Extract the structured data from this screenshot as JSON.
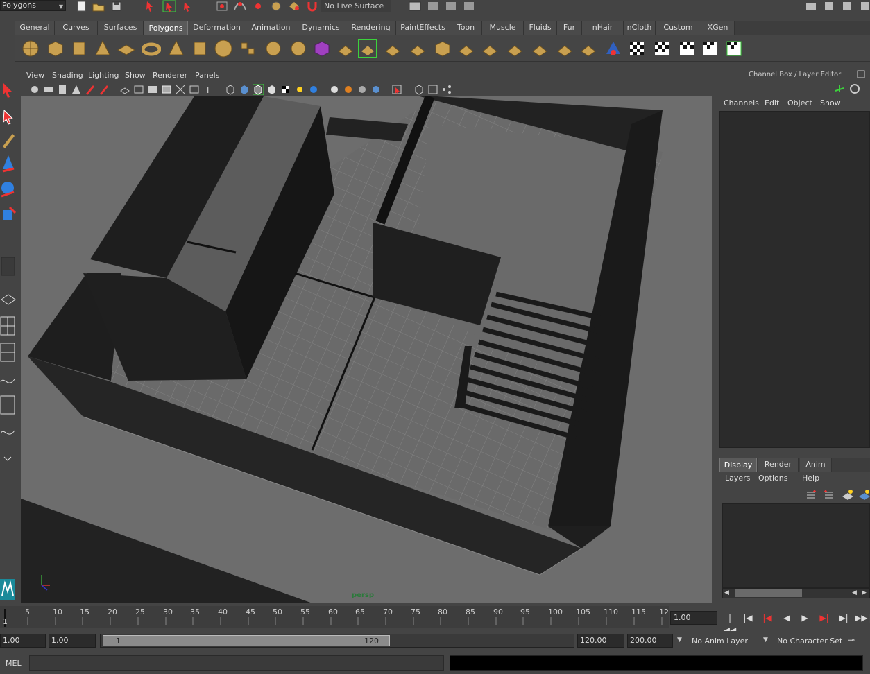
{
  "topbar": {
    "mode": "Polygons",
    "live_surface": "No Live Surface"
  },
  "shelf": {
    "tabs": [
      "General",
      "Curves",
      "Surfaces",
      "Polygons",
      "Deformation",
      "Animation",
      "Dynamics",
      "Rendering",
      "PaintEffects",
      "Toon",
      "Muscle",
      "Fluids",
      "Fur",
      "nHair",
      "nCloth",
      "Custom",
      "XGen"
    ],
    "active_tab": "Polygons"
  },
  "panel": {
    "menu": [
      "View",
      "Shading",
      "Lighting",
      "Show",
      "Renderer",
      "Panels"
    ],
    "camera": "persp"
  },
  "channel_box": {
    "title": "Channel Box / Layer Editor",
    "menu": [
      "Channels",
      "Edit",
      "Object",
      "Show"
    ]
  },
  "layer_editor": {
    "tabs": [
      "Display",
      "Render",
      "Anim"
    ],
    "active_tab": "Display",
    "menu": [
      "Layers",
      "Options",
      "Help"
    ]
  },
  "timeline": {
    "ticks": [
      "1",
      "5",
      "10",
      "15",
      "20",
      "25",
      "30",
      "35",
      "40",
      "45",
      "50",
      "55",
      "60",
      "65",
      "70",
      "75",
      "80",
      "85",
      "90",
      "95",
      "100",
      "105",
      "110",
      "115",
      "12"
    ],
    "current_frame": "1.00"
  },
  "range": {
    "start": "1.00",
    "playback_start": "1.00",
    "handle_start": "1",
    "handle_end": "120",
    "playback_end": "120.00",
    "end": "200.00",
    "anim_layer": "No Anim Layer",
    "character_set": "No Character Set"
  },
  "command": {
    "label": "MEL"
  },
  "colors": {
    "bg": "#444444",
    "field": "#2b2b2b",
    "viewport_top": "#6e8cad",
    "active_highlight": "#3cd23c"
  }
}
